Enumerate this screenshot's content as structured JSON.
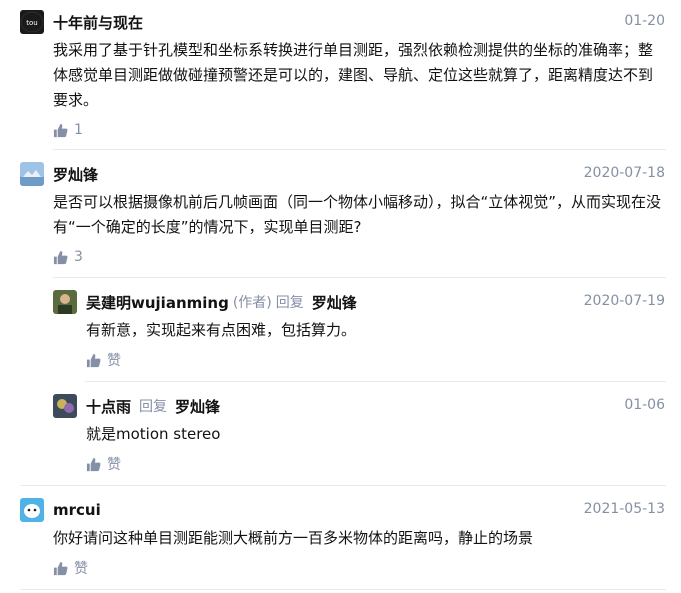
{
  "comments": [
    {
      "author": "十年前与现在",
      "date": "01-20",
      "body": "我采用了基于针孔模型和坐标系转换进行单目测距，强烈依赖检测提供的坐标的准确率；整体感觉单目测距做做碰撞预警还是可以的，建图、导航、定位这些就算了，距离精度达不到要求。",
      "likes": "1",
      "avatar_colors": {
        "bg": "#1a1a1a",
        "fg": "#ffffff"
      }
    },
    {
      "author": "罗灿锋",
      "date": "2020-07-18",
      "body": "是否可以根据摄像机前后几帧画面（同一个物体小幅移动），拟合“立体视觉”，从而实现在没有“一个确定的长度”的情况下，实现单目测距?",
      "likes": "3",
      "avatar_colors": {
        "bg": "#9fc3e6",
        "fg": "#e8f1fa"
      }
    }
  ],
  "replies": [
    {
      "author": "吴建明wujianming",
      "tag": "(作者)",
      "reply_kw": "回复",
      "reply_to": "罗灿锋",
      "date": "2020-07-19",
      "body": "有新意，实现起来有点困难，包括算力。",
      "likes": "赞",
      "avatar_colors": {
        "bg": "#5a6b3d",
        "fg": "#d9b48f"
      }
    },
    {
      "author": "十点雨",
      "reply_kw": "回复",
      "reply_to": "罗灿锋",
      "date": "01-06",
      "body": "就是motion stereo",
      "likes": "赞",
      "avatar_colors": {
        "bg": "#3d4a5c",
        "fg": "#c9b25a"
      }
    }
  ],
  "last_comment": {
    "author": "mrcui",
    "date": "2021-05-13",
    "body": "你好请问这种单目测距能测大概前方一百多米物体的距离吗，静止的场景",
    "likes": "赞",
    "avatar_colors": {
      "bg": "#4fb3e8",
      "fg": "#ffffff"
    }
  },
  "colors": {
    "meta": "#8590a6",
    "text": "#121212",
    "divider": "#ebebeb"
  }
}
